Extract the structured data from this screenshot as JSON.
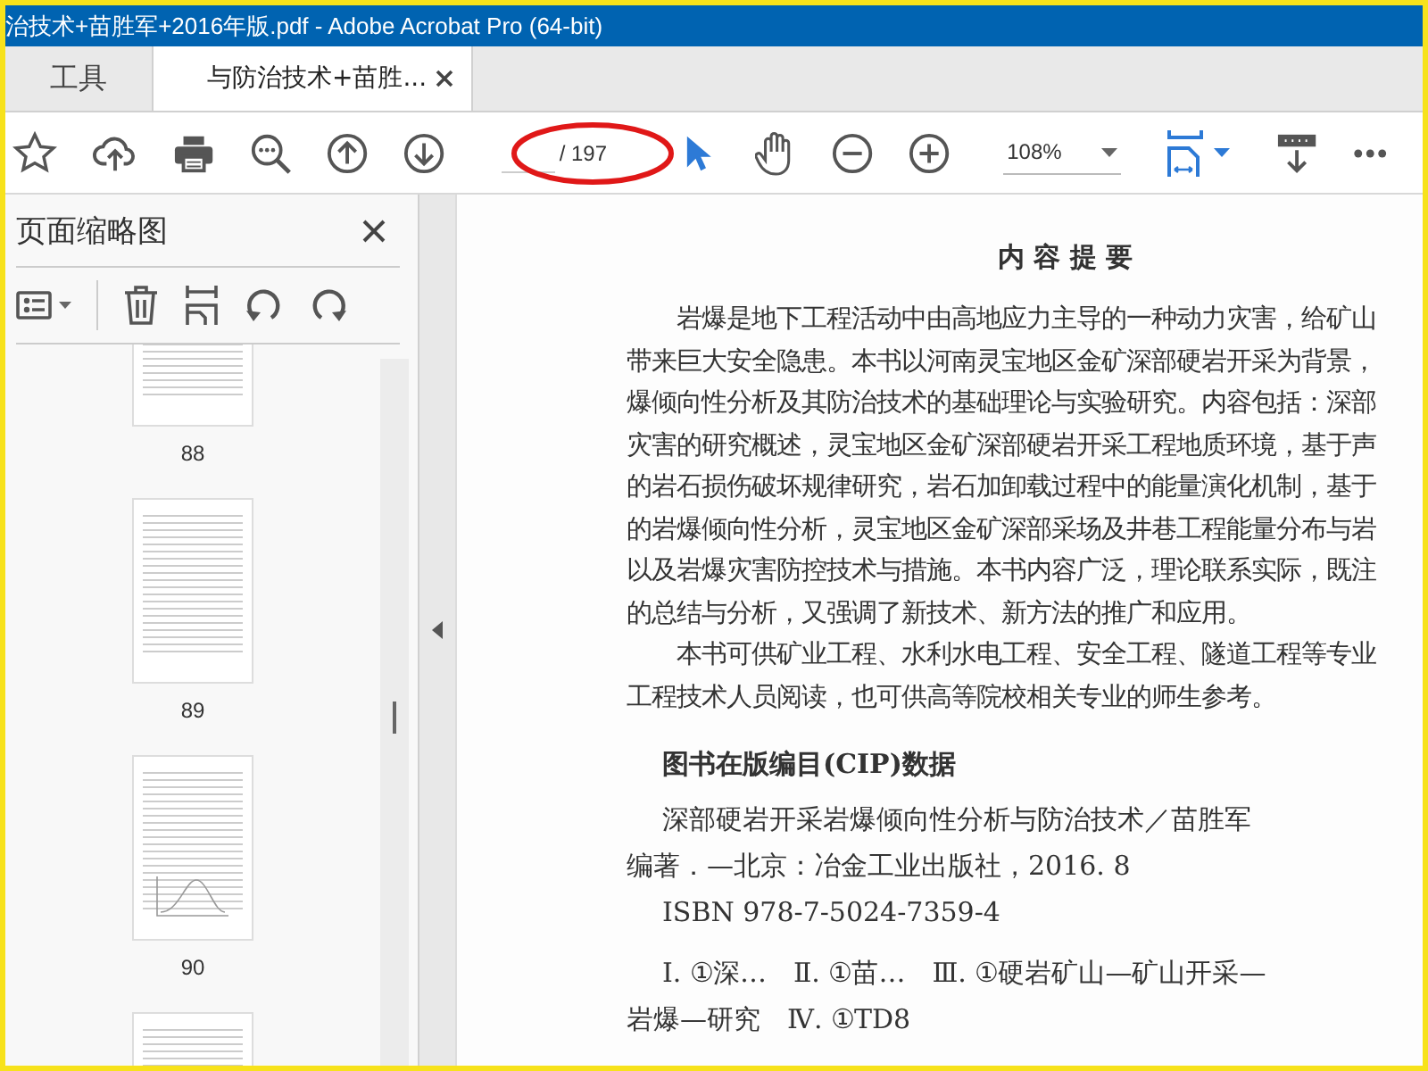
{
  "window": {
    "title": "治技术+苗胜军+2016年版.pdf - Adobe Acrobat Pro (64-bit)"
  },
  "tabs": [
    {
      "label": "工具",
      "selected": false,
      "kind": "tools"
    },
    {
      "label": "与防治技术+苗胜...",
      "selected": true,
      "kind": "document"
    }
  ],
  "toolbar": {
    "page_total": "/ 197",
    "zoom": "108%"
  },
  "sidebar": {
    "title": "页面缩略图",
    "thumbnails": [
      {
        "page": "88",
        "kind": "text"
      },
      {
        "page": "89",
        "kind": "text"
      },
      {
        "page": "90",
        "kind": "chart"
      },
      {
        "kind": "text"
      }
    ]
  },
  "document": {
    "heading": "内 容 提 要",
    "paragraphs": [
      {
        "lines": [
          "岩爆是地下工程活动中由高地应力主导的一种动力灾害，给矿山",
          "带来巨大安全隐患。本书以河南灵宝地区金矿深部硬岩开采为背景，",
          "爆倾向性分析及其防治技术的基础理论与实验研究。内容包括：深部",
          "灾害的研究概述，灵宝地区金矿深部硬岩开采工程地质环境，基于声",
          "的岩石损伤破坏规律研究，岩石加卸载过程中的能量演化机制，基于",
          "的岩爆倾向性分析，灵宝地区金矿深部采场及井巷工程能量分布与岩",
          "以及岩爆灾害防控技术与措施。本书内容广泛，理论联系实际，既注",
          "的总结与分析，又强调了新技术、新方法的推广和应用。"
        ]
      },
      {
        "lines": [
          "本书可供矿业工程、水利水电工程、安全工程、隧道工程等专业",
          "工程技术人员阅读，也可供高等院校相关专业的师生参考。"
        ]
      }
    ],
    "cip_heading": "图书在版编目(CIP)数据",
    "cip": [
      {
        "lines": [
          "深部硬岩开采岩爆倾向性分析与防治技术／苗胜军",
          "编著．—北京：冶金工业出版社，2016. 8"
        ]
      },
      {
        "lines": [
          "ISBN 978-7-5024-7359-4"
        ]
      },
      {
        "lines": [
          "Ⅰ. ①深…　Ⅱ. ①苗…　Ⅲ. ①硬岩矿山—矿山开采—",
          "岩爆—研究　Ⅳ. ①TD8"
        ]
      }
    ]
  }
}
